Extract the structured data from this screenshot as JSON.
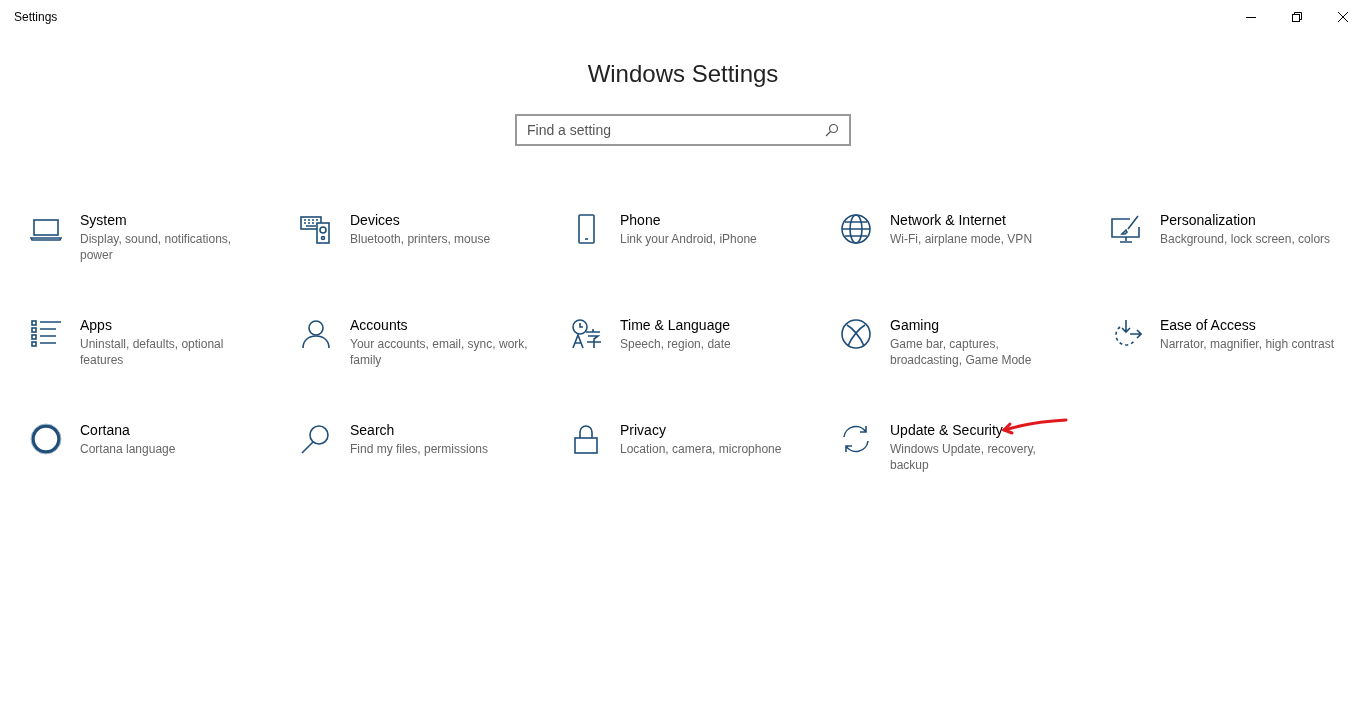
{
  "window": {
    "title": "Settings"
  },
  "heading": "Windows Settings",
  "search": {
    "placeholder": "Find a setting"
  },
  "tiles": [
    {
      "title": "System",
      "description": "Display, sound, notifications, power"
    },
    {
      "title": "Devices",
      "description": "Bluetooth, printers, mouse"
    },
    {
      "title": "Phone",
      "description": "Link your Android, iPhone"
    },
    {
      "title": "Network & Internet",
      "description": "Wi-Fi, airplane mode, VPN"
    },
    {
      "title": "Personalization",
      "description": "Background, lock screen, colors"
    },
    {
      "title": "Apps",
      "description": "Uninstall, defaults, optional features"
    },
    {
      "title": "Accounts",
      "description": "Your accounts, email, sync, work, family"
    },
    {
      "title": "Time & Language",
      "description": "Speech, region, date"
    },
    {
      "title": "Gaming",
      "description": "Game bar, captures, broadcasting, Game Mode"
    },
    {
      "title": "Ease of Access",
      "description": "Narrator, magnifier, high contrast"
    },
    {
      "title": "Cortana",
      "description": "Cortana language"
    },
    {
      "title": "Search",
      "description": "Find my files, permissions"
    },
    {
      "title": "Privacy",
      "description": "Location, camera, microphone"
    },
    {
      "title": "Update & Security",
      "description": "Windows Update, recovery, backup",
      "annotated": true
    }
  ]
}
